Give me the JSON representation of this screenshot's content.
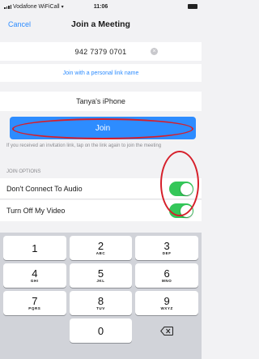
{
  "status_bar": {
    "carrier": "Vodafone WiFiCall",
    "time": "11:06"
  },
  "nav": {
    "cancel_label": "Cancel",
    "title": "Join a Meeting"
  },
  "meeting_id": {
    "value": "942 7379 0701"
  },
  "personal_link_label": "Join with a personal link name",
  "display_name": {
    "value": "Tanya's iPhone"
  },
  "join_button_label": "Join",
  "hint_text": "If you received an invitation link, tap on the link again to join the meeting",
  "join_options": {
    "header": "JOIN OPTIONS",
    "items": [
      {
        "label": "Don't Connect To Audio",
        "enabled": true
      },
      {
        "label": "Turn Off My Video",
        "enabled": true
      }
    ]
  },
  "keypad": {
    "keys": [
      {
        "digit": "1",
        "letters": ""
      },
      {
        "digit": "2",
        "letters": "ABC"
      },
      {
        "digit": "3",
        "letters": "DEF"
      },
      {
        "digit": "4",
        "letters": "GHI"
      },
      {
        "digit": "5",
        "letters": "JKL"
      },
      {
        "digit": "6",
        "letters": "MNO"
      },
      {
        "digit": "7",
        "letters": "PQRS"
      },
      {
        "digit": "8",
        "letters": "TUV"
      },
      {
        "digit": "9",
        "letters": "WXYZ"
      },
      {
        "digit": "0",
        "letters": ""
      }
    ]
  },
  "colors": {
    "accent": "#2d8cff",
    "toggle_on": "#34c759",
    "annotation": "#d61f2a"
  }
}
